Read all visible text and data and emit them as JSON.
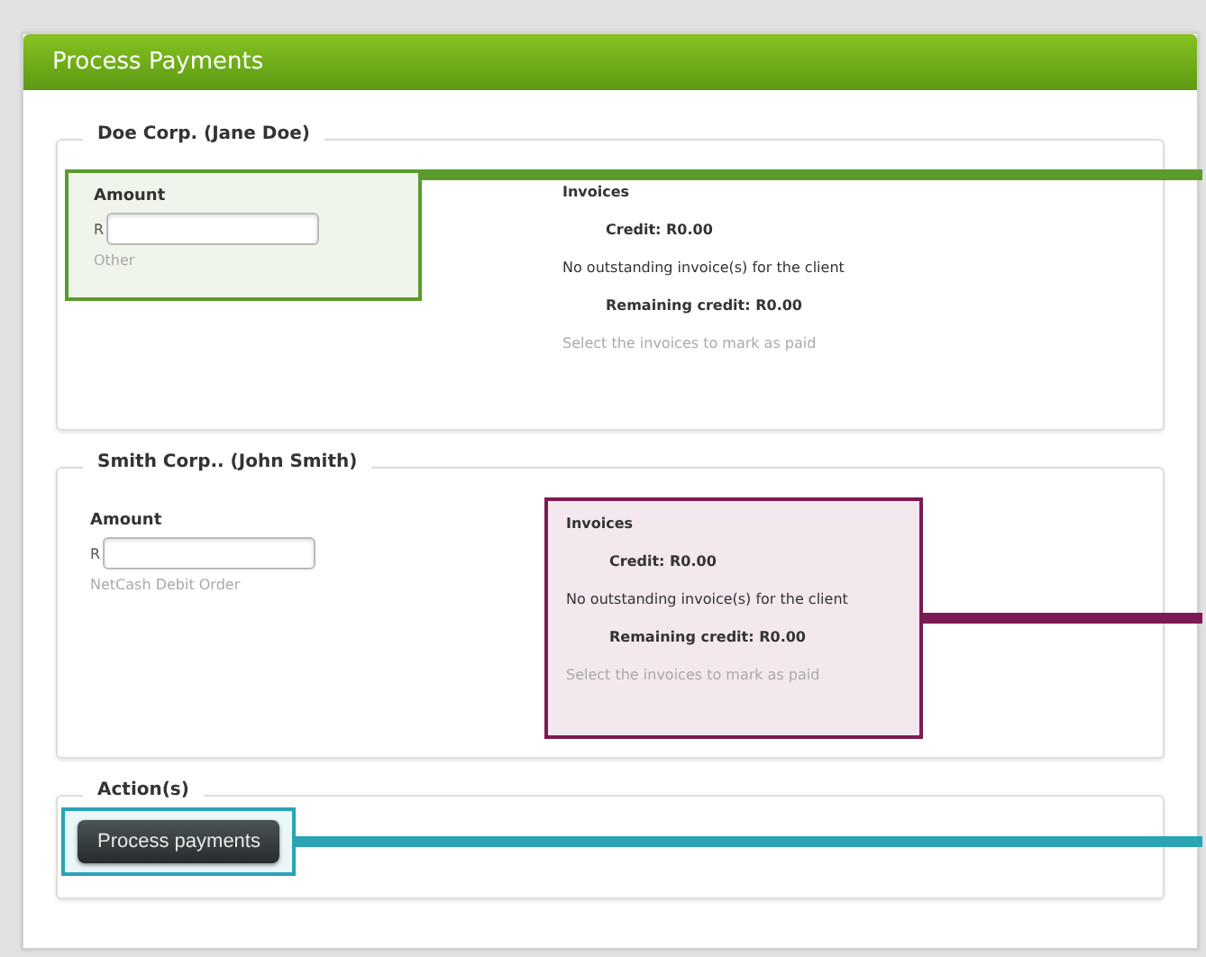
{
  "title": "Process Payments",
  "clients": [
    {
      "legend": "Doe Corp. (Jane Doe)",
      "amount_label": "Amount",
      "currency": "R",
      "amount_hint": "Other",
      "invoices_heading": "Invoices",
      "credit": "Credit: R0.00",
      "message": "No outstanding invoice(s) for the client",
      "remaining": "Remaining credit: R0.00",
      "instruction": "Select the invoices to mark as paid",
      "highlight": {
        "amount": true,
        "invoices": false,
        "color": "#5b9a2c"
      }
    },
    {
      "legend": "Smith Corp.. (John Smith)",
      "amount_label": "Amount",
      "currency": "R",
      "amount_hint": "NetCash Debit Order",
      "invoices_heading": "Invoices",
      "credit": "Credit: R0.00",
      "message": "No outstanding invoice(s) for the client",
      "remaining": "Remaining credit: R0.00",
      "instruction": "Select the invoices to mark as paid",
      "highlight": {
        "amount": false,
        "invoices": true,
        "color": "#7e1a52"
      }
    }
  ],
  "actions": {
    "legend": "Action(s)",
    "button": "Process payments",
    "highlight": {
      "color": "#2aa4b4"
    }
  }
}
